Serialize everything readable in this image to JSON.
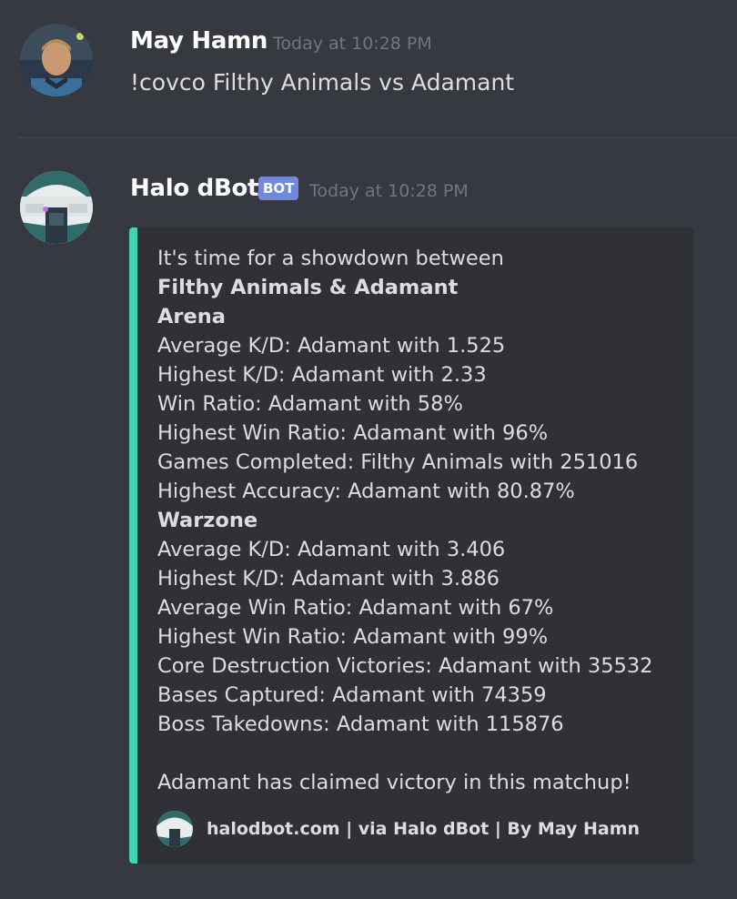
{
  "messages": [
    {
      "author": "May Hamn",
      "timestamp": "Today at 10:28 PM",
      "content": "!covco Filthy Animals vs  Adamant"
    },
    {
      "author": "Halo dBot",
      "badge": "BOT",
      "timestamp": "Today at 10:28 PM",
      "embed": {
        "accent_color": "#43d3b4",
        "intro": "It's time for a showdown between",
        "matchup": "Filthy Animals & Adamant",
        "arena_heading": "Arena",
        "arena_stats": [
          "Average K/D: Adamant with 1.525",
          "Highest K/D: Adamant with 2.33",
          "Win Ratio: Adamant with 58%",
          "Highest Win Ratio: Adamant with 96%",
          "Games Completed: Filthy Animals with 251016",
          "Highest Accuracy: Adamant with 80.87%"
        ],
        "warzone_heading": "Warzone",
        "warzone_stats": [
          "Average K/D: Adamant with 3.406",
          "Highest K/D: Adamant with 3.886",
          "Average Win Ratio: Adamant with 67%",
          "Highest Win Ratio: Adamant with 99%",
          "Core Destruction Victories: Adamant with 35532",
          "Bases Captured: Adamant with 74359",
          "Boss Takedowns: Adamant with 115876"
        ],
        "conclusion": "Adamant has claimed victory in this matchup!",
        "footer": "halodbot.com | via Halo dBot | By May Hamn"
      }
    }
  ],
  "colors": {
    "background": "#36393f",
    "embed_background": "#2f3136",
    "bot_badge": "#7289da",
    "timestamp": "#72767d"
  },
  "icons": {
    "user_avatar": "user-avatar-icon",
    "bot_avatar": "halo-helmet-icon",
    "footer_icon": "halo-helmet-icon"
  }
}
